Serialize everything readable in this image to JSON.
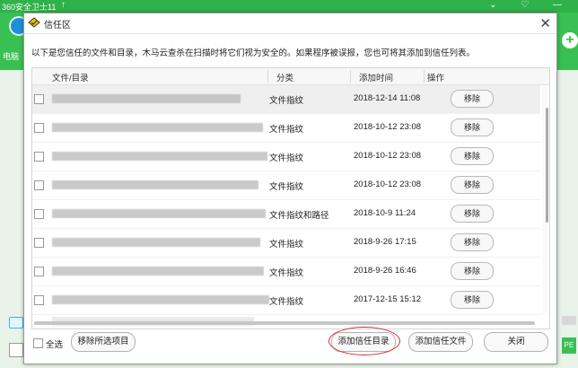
{
  "app": {
    "title": "360安全卫士11",
    "title_arrow": "↑",
    "controls": "⌄ ♡ —",
    "left_text": "电脑",
    "right_button": "+",
    "badge_text": "PE"
  },
  "dialog": {
    "title": "信任区",
    "close_label": "✕",
    "description": "以下是您信任的文件和目录，木马云查杀在扫描时将它们视为安全的。如果程序被误报，您也可将其添加到信任列表。",
    "columns": [
      "文件/目录",
      "分类",
      "添加时间",
      "操作"
    ],
    "rows": [
      {
        "type": "文件指纹",
        "time": "2018-12-14 11:08",
        "action": "移除"
      },
      {
        "type": "文件指纹",
        "time": "2018-10-12 23:08",
        "action": "移除"
      },
      {
        "type": "文件指纹",
        "time": "2018-10-12 23:08",
        "action": "移除"
      },
      {
        "type": "文件指纹",
        "time": "2018-10-12 23:08",
        "action": "移除"
      },
      {
        "type": "文件指纹和路径",
        "time": "2018-10-9 11:24",
        "action": "移除"
      },
      {
        "type": "文件指纹",
        "time": "2018-9-26 17:15",
        "action": "移除"
      },
      {
        "type": "文件指纹",
        "time": "2018-9-26 16:46",
        "action": "移除"
      },
      {
        "type": "文件指纹",
        "time": "2017-12-15 15:12",
        "action": "移除"
      }
    ],
    "footer": {
      "select_all": "全选",
      "remove_selected": "移除所选项目",
      "add_dir": "添加信任目录",
      "add_file": "添加信任文件",
      "close": "关闭"
    }
  }
}
